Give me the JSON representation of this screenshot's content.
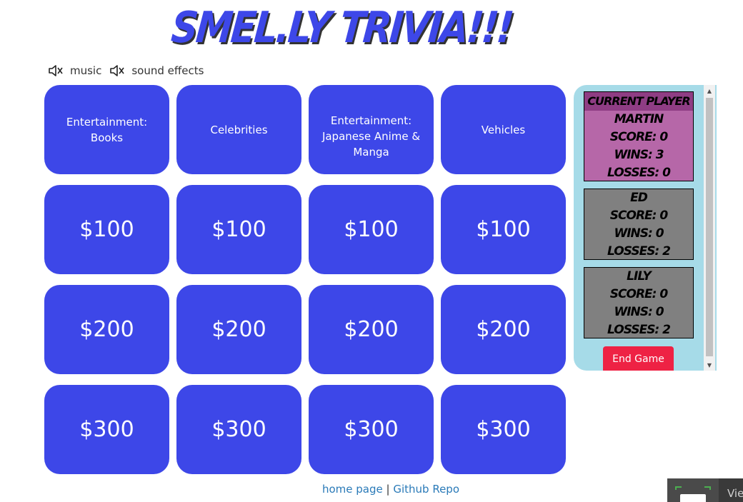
{
  "header": {
    "title": "SMEL.LY TRIVIA!!!"
  },
  "audio": {
    "music_label": "music",
    "sfx_label": "sound effects"
  },
  "board": {
    "categories": [
      "Entertainment: Books",
      "Celebrities",
      "Entertainment: Japanese Anime & Manga",
      "Vehicles"
    ],
    "rows": [
      [
        "$100",
        "$100",
        "$100",
        "$100"
      ],
      [
        "$200",
        "$200",
        "$200",
        "$200"
      ],
      [
        "$300",
        "$300",
        "$300",
        "$300"
      ]
    ]
  },
  "scoreboard": {
    "current_label": "CURRENT PLAYER",
    "players": [
      {
        "name": "MARTIN",
        "score": "SCORE: 0",
        "wins": "WINS: 3",
        "losses": "LOSSES: 0"
      },
      {
        "name": "ED",
        "score": "SCORE: 0",
        "wins": "WINS: 0",
        "losses": "LOSSES: 2"
      },
      {
        "name": "LILY",
        "score": "SCORE: 0",
        "wins": "WINS: 0",
        "losses": "LOSSES: 2"
      }
    ],
    "end_game_label": "End Game"
  },
  "footer": {
    "home_link": "home page",
    "separator": "|",
    "github_link": "Github Repo"
  },
  "corner_widget": {
    "text": "Vie"
  },
  "colors": {
    "tile": "#3d47e8",
    "panel": "#a6dbe8",
    "current": "#b667a8",
    "other": "#808080",
    "end_button": "#ee2244",
    "link": "#2a7ab8"
  }
}
